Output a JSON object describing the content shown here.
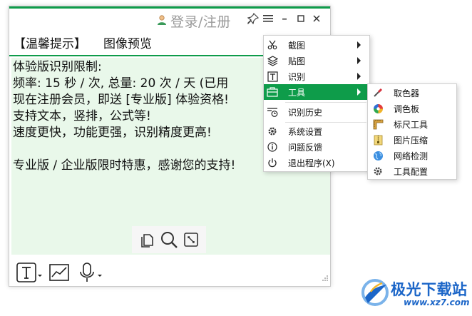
{
  "colors": {
    "accent": "#0e9c4a",
    "content_bg": "#e9f8ea",
    "brand_blue": "#1c66c8"
  },
  "header": {
    "login_label": "登录/注册",
    "icons": [
      "user-icon",
      "pin-icon",
      "hamburger-menu-icon",
      "minimize-icon",
      "maximize-icon",
      "close-icon"
    ]
  },
  "tabs": [
    {
      "label": "【温馨提示】"
    },
    {
      "label": "图像预览"
    }
  ],
  "content": {
    "lines": [
      "体验版识别限制:",
      "频率: 15 秒 / 次, 总量: 20 次 / 天 (已用",
      "现在注册会员，即送 [专业版] 体验资格!",
      "支持文本，竖排，公式等!",
      "速度更快，功能更强，识别精度更高!",
      "",
      "专业版 / 企业版限时特惠，感谢您的支持!"
    ]
  },
  "mini_tools": [
    "copy-icon",
    "search-icon",
    "fit-screen-icon"
  ],
  "bottom_bar": [
    "text-mode-icon",
    "chart-icon",
    "microphone-icon"
  ],
  "menu": {
    "items": [
      {
        "label": "截图",
        "icon": "scissors-icon",
        "has_submenu": true
      },
      {
        "label": "贴图",
        "icon": "layers-icon",
        "has_submenu": true
      },
      {
        "label": "识别",
        "icon": "text-recognize-icon",
        "has_submenu": true
      },
      {
        "label": "工具",
        "icon": "toolbox-icon",
        "has_submenu": true,
        "highlighted": true
      },
      {
        "label": "识别历史",
        "icon": "history-icon",
        "has_submenu": false
      },
      {
        "label": "系统设置",
        "icon": "gear-icon",
        "has_submenu": false
      },
      {
        "label": "问题反馈",
        "icon": "info-icon",
        "has_submenu": false
      },
      {
        "label": "退出程序(X)",
        "icon": "power-icon",
        "has_submenu": false
      }
    ]
  },
  "submenu": {
    "items": [
      {
        "label": "取色器",
        "icon": "color-picker-icon"
      },
      {
        "label": "调色板",
        "icon": "palette-icon"
      },
      {
        "label": "标尺工具",
        "icon": "ruler-icon"
      },
      {
        "label": "图片压缩",
        "icon": "zip-icon"
      },
      {
        "label": "网络检测",
        "icon": "globe-icon"
      },
      {
        "label": "工具配置",
        "icon": "gear-icon"
      }
    ]
  },
  "watermark": {
    "title": "极光下载站",
    "url": "www.xz7.com"
  }
}
